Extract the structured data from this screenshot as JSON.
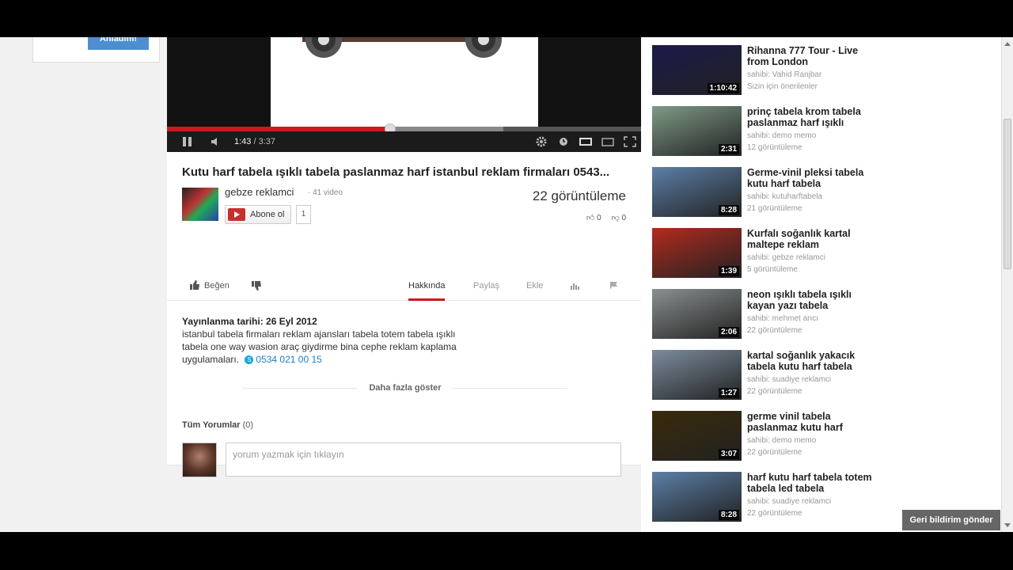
{
  "left_card": {
    "button_label": "Anladım!"
  },
  "player": {
    "current_time": "1:43",
    "separator": "/",
    "duration": "3:37",
    "progress_played": 0.47,
    "progress_loaded": 0.71
  },
  "video": {
    "title": "Kutu harf tabela ışıklı tabela paslanmaz harf istanbul reklam firmaları 0543...",
    "channel_name": "gebze reklamci",
    "channel_video_count": "· 41 video",
    "subscribe_label": "Abone ol",
    "subscriber_count": "1",
    "views": "22 görüntüleme",
    "likes": "0",
    "dislikes": "0"
  },
  "actions": {
    "like_label": "Beğen",
    "tabs": [
      "Hakkında",
      "Paylaş",
      "Ekle"
    ]
  },
  "about": {
    "published": "Yayınlanma tarihi: 26 Eyl 2012",
    "description": "istanbul tabela firmaları reklam ajansları tabela totem tabela ışıklı tabela one way wasion araç giydirme bina cephe reklam kaplama uygulamaları.",
    "phone": "0534 021 00 15",
    "show_more": "Daha fazla göster"
  },
  "comments": {
    "header": "Tüm Yorumlar",
    "count": "(0)",
    "placeholder": "yorum yazmak için tıklayın"
  },
  "related": [
    {
      "title": "Rihanna 777 Tour - Live from London",
      "owner": "sahibi: Vahid Ranjbar",
      "meta": "Sizin için önerilenler",
      "duration": "1:10:42",
      "thumb": "#1a1a4a"
    },
    {
      "title": "prinç tabela krom tabela paslanmaz harf ışıklı",
      "owner": "sahibi: demo memo",
      "meta": "12 görüntüleme",
      "duration": "2:31",
      "thumb": "#7f9a86"
    },
    {
      "title": "Germe-vinil pleksi tabela kutu harf tabela",
      "owner": "sahibi: kutuharftabela",
      "meta": "21 görüntüleme",
      "duration": "8:28",
      "thumb": "#5c7fa6"
    },
    {
      "title": "Kurfalı soğanlık kartal maltepe reklam",
      "owner": "sahibi: gebze reklamci",
      "meta": "5 görüntüleme",
      "duration": "1:39",
      "thumb": "#b22a1e"
    },
    {
      "title": "neon ışıklı tabela ışıklı kayan yazı tabela",
      "owner": "sahibi: mehmet arıcı",
      "meta": "22 görüntüleme",
      "duration": "2:06",
      "thumb": "#8a8f90"
    },
    {
      "title": "kartal soğanlık yakacık tabela kutu harf tabela",
      "owner": "sahibi: suadiye reklamci",
      "meta": "22 görüntüleme",
      "duration": "1:27",
      "thumb": "#7c8c9d"
    },
    {
      "title": "germe vinil tabela paslanmaz kutu harf",
      "owner": "sahibi: demo memo",
      "meta": "22 görüntüleme",
      "duration": "3:07",
      "thumb": "#3a2a0a"
    },
    {
      "title": "harf kutu harf tabela totem tabela led tabela",
      "owner": "sahibi: suadiye reklamci",
      "meta": "22 görüntüleme",
      "duration": "8:28",
      "thumb": "#5c7fa6"
    }
  ],
  "feedback_label": "Geri bildirim gönder"
}
